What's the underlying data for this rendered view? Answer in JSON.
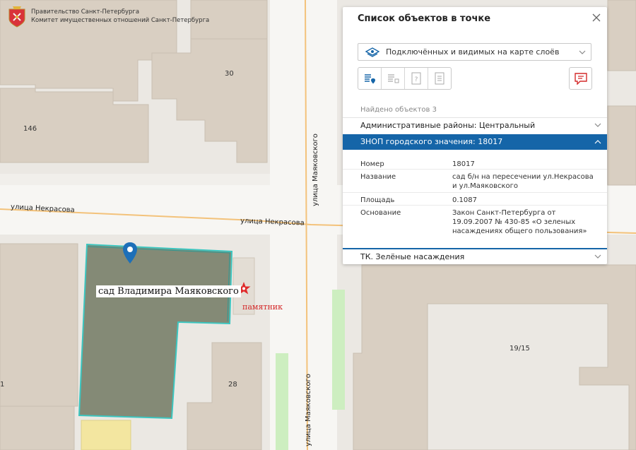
{
  "header": {
    "line1": "Правительство Санкт-Петербурга",
    "line2": "Комитет имущественных отношений Санкт-Петербурга"
  },
  "map": {
    "building_labels": [
      "30",
      "146",
      "28",
      "19/15",
      "1"
    ],
    "street_labels": {
      "nekrasova_left": "улица Некрасова",
      "nekrasova_right": "улица Некрасова",
      "mayakovskogo_top": "улица Маяковского",
      "mayakovskogo_bottom": "улица Маяковского"
    },
    "garden_label": "сад Владимира Маяковского",
    "monument_label": "памятник",
    "colors": {
      "background": "#ebe8e3",
      "building": "#d9cfc2",
      "garden_fill": "#848a76",
      "garden_border": "#3cc6c0",
      "road": "#ffffff",
      "street_line": "#f3c27a",
      "green_strip": "#cdeec0",
      "marker": "#1d6fb8",
      "monument": "#e02a2a",
      "yellow_building": "#f3e6a0"
    }
  },
  "panel": {
    "title": "Список объектов в точке",
    "layer_select": {
      "value": "Подключённых и видимых на карте слоёв",
      "icon": "layers-icon"
    },
    "toolbar": [
      "list-location-icon",
      "list-grid-icon",
      "help-doc-icon",
      "document-icon"
    ],
    "report_icon": "report-icon",
    "found_text": "Найдено объектов 3",
    "sections": {
      "admin": "Административные районы: Центральный",
      "znop": "ЗНОП городского значения: 18017",
      "green": "ТК. Зелёные насаждения"
    },
    "properties": [
      {
        "key": "Номер",
        "value": "18017"
      },
      {
        "key": "Название",
        "value": "сад б/н на пересечении ул.Некрасова и ул.Маяковского"
      },
      {
        "key": "Площадь",
        "value": "0.1087"
      },
      {
        "key": "Основание",
        "value": "Закон Санкт-Петербурга от 19.09.2007 № 430-85 «О зеленых насаждениях общего пользования»"
      }
    ],
    "accent_color": "#1565a8"
  }
}
